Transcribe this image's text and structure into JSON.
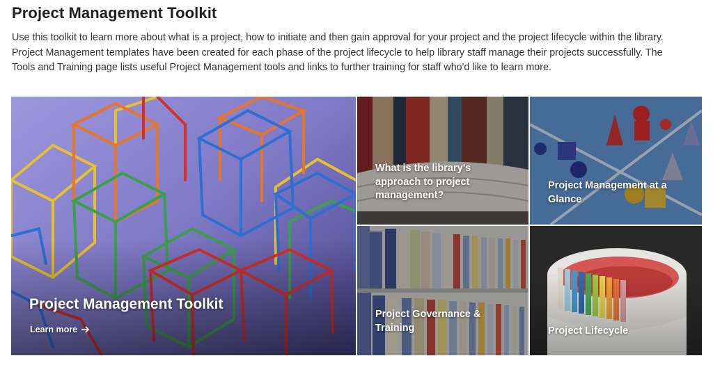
{
  "page": {
    "title": "Project Management Toolkit",
    "intro_lines": [
      "Use this toolkit to learn more about what is a project, how to initiate and then gain approval for your project and the project lifecycle within the library.",
      "Project Management templates have been created for each phase of the project lifecycle to help library staff manage their projects successfully. The",
      "Tools and Training page lists useful Project Management tools and links to further training for staff who'd like to learn more."
    ]
  },
  "hero": {
    "title": "Project Management Toolkit",
    "link_label": "Learn more",
    "link_icon": "arrow-right-icon"
  },
  "tiles": {
    "approach": {
      "line1": "What is the library's",
      "line2": "approach to project",
      "line3": "management?"
    },
    "glance": {
      "line1": "Project Management at a",
      "line2": "Glance"
    },
    "governance": {
      "line1": "Project Governance &",
      "line2": "Training"
    },
    "lifecycle": {
      "line1": "Project Lifecycle"
    }
  }
}
